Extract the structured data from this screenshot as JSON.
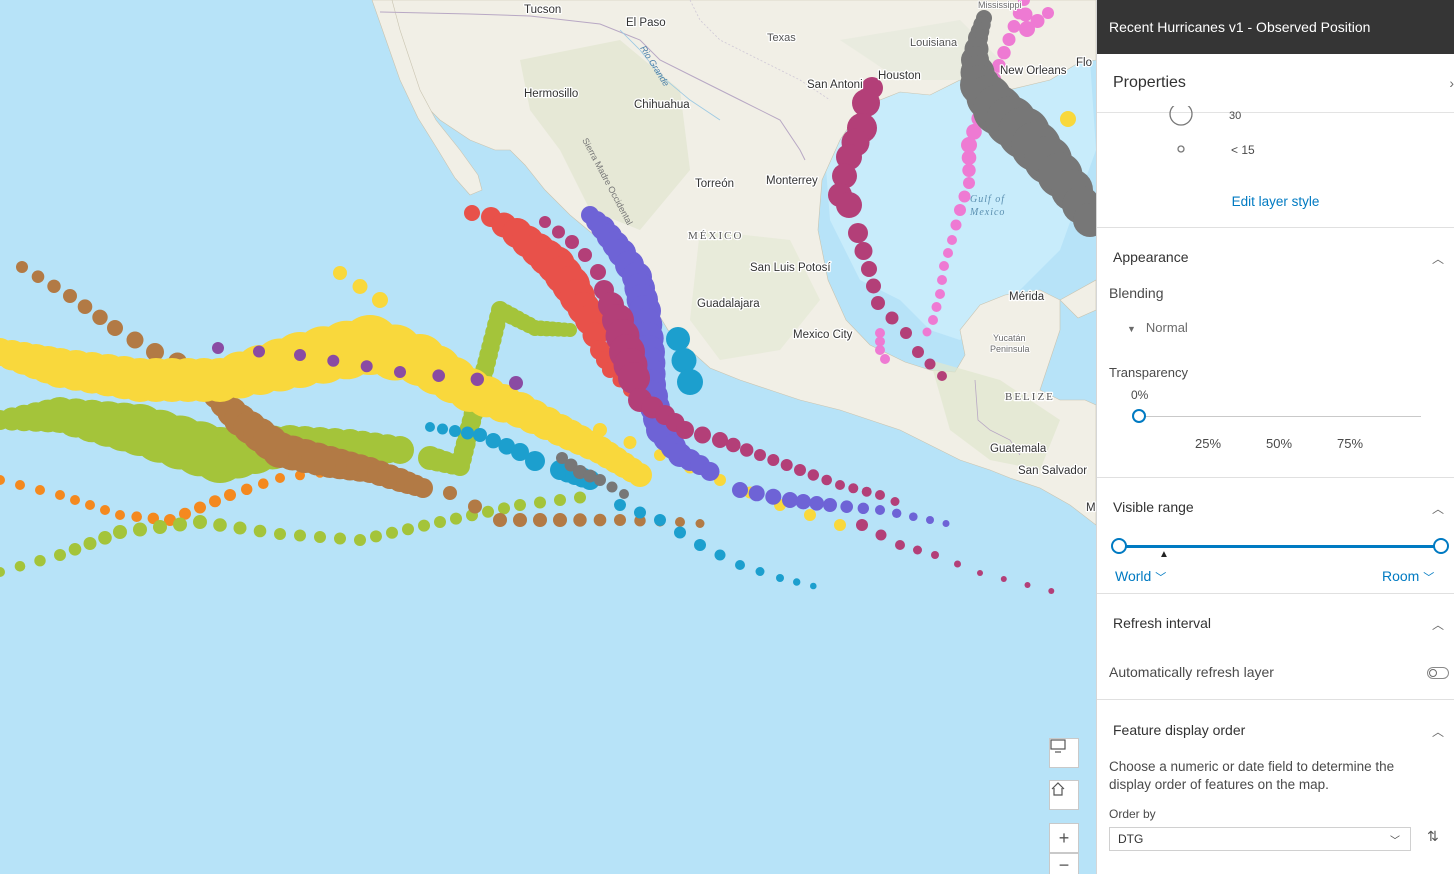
{
  "map": {
    "labels": {
      "tucson": "Tucson",
      "el_paso": "El Paso",
      "texas": "Texas",
      "louisiana": "Louisiana",
      "mississippi": "Mississippi",
      "hermosillo": "Hermosillo",
      "chihuahua": "Chihuahua",
      "san_antonio": "San Antoni",
      "houston": "Houston",
      "new_orleans": "New Orleans",
      "flo": "Flo",
      "rio_grande": "Rio Grande",
      "torreon": "Torreón",
      "monterrey": "Monterrey",
      "sierra": "Sierra Madre Occidental",
      "mexico": "MÉXICO",
      "gulf": "Gulf of",
      "gulf2": "Mexico",
      "slp": "San Luis Potosí",
      "merida": "Mérida",
      "guadalajara": "Guadalajara",
      "mexico_city": "Mexico City",
      "yucatan": "Yucatán",
      "peninsula": "Peninsula",
      "belize": "BELIZE",
      "guatemala": "Guatemala",
      "san_salvador": "San Salvador",
      "m": "M"
    },
    "buttons": {
      "screen_icon": "monitor-icon",
      "home_icon": "home-icon",
      "zoom_in": "+",
      "zoom_out": "−"
    },
    "colors": {
      "ocean": "#b7e3f8",
      "land": "#f1efe6",
      "red": "#e8514a",
      "magenta": "#b33f78",
      "violet": "#6e63d6",
      "blue": "#1c9fce",
      "yellow": "#f9d83c",
      "green": "#a4c43a",
      "brown": "#b27a45",
      "orange": "#f4891f",
      "gray": "#777777",
      "pink": "#ee7ad3",
      "purple": "#8a4ba3"
    }
  },
  "panel": {
    "title": "Recent Hurricanes v1 - Observed Position",
    "subtitle": "Properties",
    "legend": {
      "value_30": "30",
      "value_lt15": "< 15"
    },
    "edit_style": "Edit layer style",
    "appearance": {
      "title": "Appearance",
      "blending_label": "Blending",
      "blending_value": "Normal",
      "transparency_label": "Transparency",
      "transparency_value": "0%",
      "ticks": [
        "25%",
        "50%",
        "75%"
      ]
    },
    "visible_range": {
      "title": "Visible range",
      "min_label": "World",
      "max_label": "Room"
    },
    "refresh": {
      "title": "Refresh interval",
      "auto_label": "Automatically refresh layer",
      "auto_on": false
    },
    "display_order": {
      "title": "Feature display order",
      "description": "Choose a numeric or date field to determine the display order of features on the map.",
      "order_by_label": "Order by",
      "order_by_value": "DTG"
    }
  }
}
